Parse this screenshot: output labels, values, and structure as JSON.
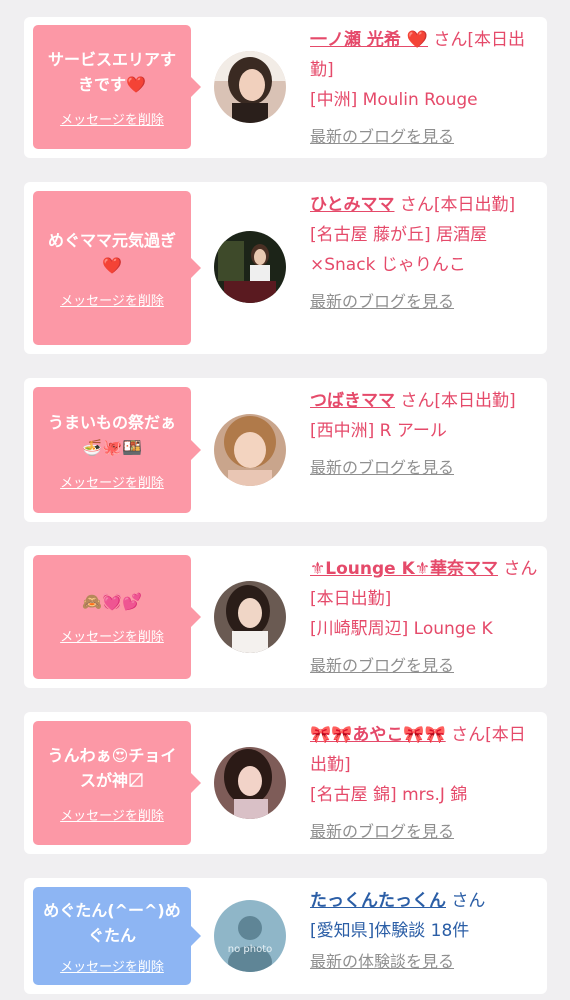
{
  "cards": [
    {
      "message": "サービスエリアすきです❤️",
      "delete_label": "メッセージを削除",
      "name": "一ノ瀬 光希 ❤️",
      "suffix": "さん[本日出勤]",
      "shop": "[中洲] Moulin Rouge",
      "link": "最新のブログを見る",
      "bubble_color": "#fc98a6",
      "avatar_icon": "woman-portrait-photo"
    },
    {
      "message": "めぐママ元気過ぎ❤️",
      "delete_label": "メッセージを削除",
      "name": "ひとみママ",
      "suffix": "さん[本日出勤]",
      "shop": "[名古屋 藤が丘] 居酒屋×Snack じゃりんこ",
      "link": "最新のブログを見る",
      "bubble_color": "#fc98a6",
      "avatar_icon": "woman-in-bar-photo"
    },
    {
      "message": "うまいもの祭だぁ🍜🐙🍱",
      "delete_label": "メッセージを削除",
      "name": "つばきママ",
      "suffix": "さん[本日出勤]",
      "shop": "[西中洲] R アール",
      "link": "最新のブログを見る",
      "bubble_color": "#fc98a6",
      "avatar_icon": "woman-portrait-photo"
    },
    {
      "message": "🙈💓💕",
      "delete_label": "メッセージを削除",
      "name": "⚜Lounge K⚜華奈ママ",
      "suffix": "さん[本日出勤]",
      "shop": "[川崎駅周辺] Lounge K",
      "link": "最新のブログを見る",
      "bubble_color": "#fc98a6",
      "avatar_icon": "woman-portrait-photo"
    },
    {
      "message": "うんわぁ😍チョイスが神〼",
      "delete_label": "メッセージを削除",
      "name": "🎀🎀あやこ🎀🎀",
      "suffix": "さん[本日出勤]",
      "shop": "[名古屋 錦] mrs.J 錦",
      "link": "最新のブログを見る",
      "bubble_color": "#fc98a6",
      "avatar_icon": "woman-portrait-photo"
    },
    {
      "message": "めぐたん(^ー^)めぐたん",
      "delete_label": "メッセージを削除",
      "name": "たっくんたっくん",
      "suffix": "さん",
      "shop": "[愛知県]体験談 18件",
      "link": "最新の体験談を見る",
      "bubble_color": "#8db5f3",
      "avatar_icon": "no-photo-placeholder",
      "avatar_text": "no photo"
    }
  ]
}
